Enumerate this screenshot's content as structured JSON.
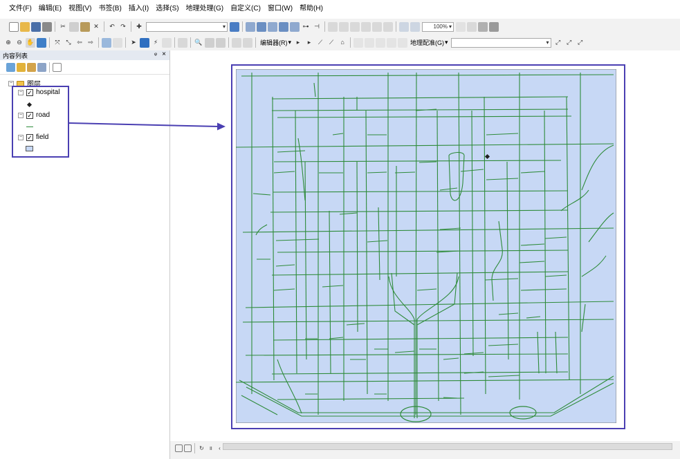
{
  "menu": {
    "items": [
      "文件(F)",
      "编辑(E)",
      "视图(V)",
      "书签(B)",
      "插入(I)",
      "选择(S)",
      "地理处理(G)",
      "自定义(C)",
      "窗口(W)",
      "帮助(H)"
    ]
  },
  "toolbar": {
    "zoom_value": "100%",
    "editor_label": "编辑器(R)",
    "georef_label": "地理配准(G)"
  },
  "toc": {
    "title": "内容列表",
    "group_name": "图层",
    "layers": [
      {
        "name": "hospital",
        "symbol": "point",
        "symbol_color": "#222222"
      },
      {
        "name": "road",
        "symbol": "line",
        "symbol_color": "#2e8b3a"
      },
      {
        "name": "field",
        "symbol": "fill",
        "symbol_color": "#c7d8f5"
      }
    ]
  },
  "map": {
    "field_color": "#c7d8f5",
    "road_color": "#2e8b3a",
    "frame_color": "#4a3fb2",
    "hospital_color": "#222222"
  },
  "icons": {
    "toc_close": "×",
    "toc_pin": "ᵠ"
  }
}
